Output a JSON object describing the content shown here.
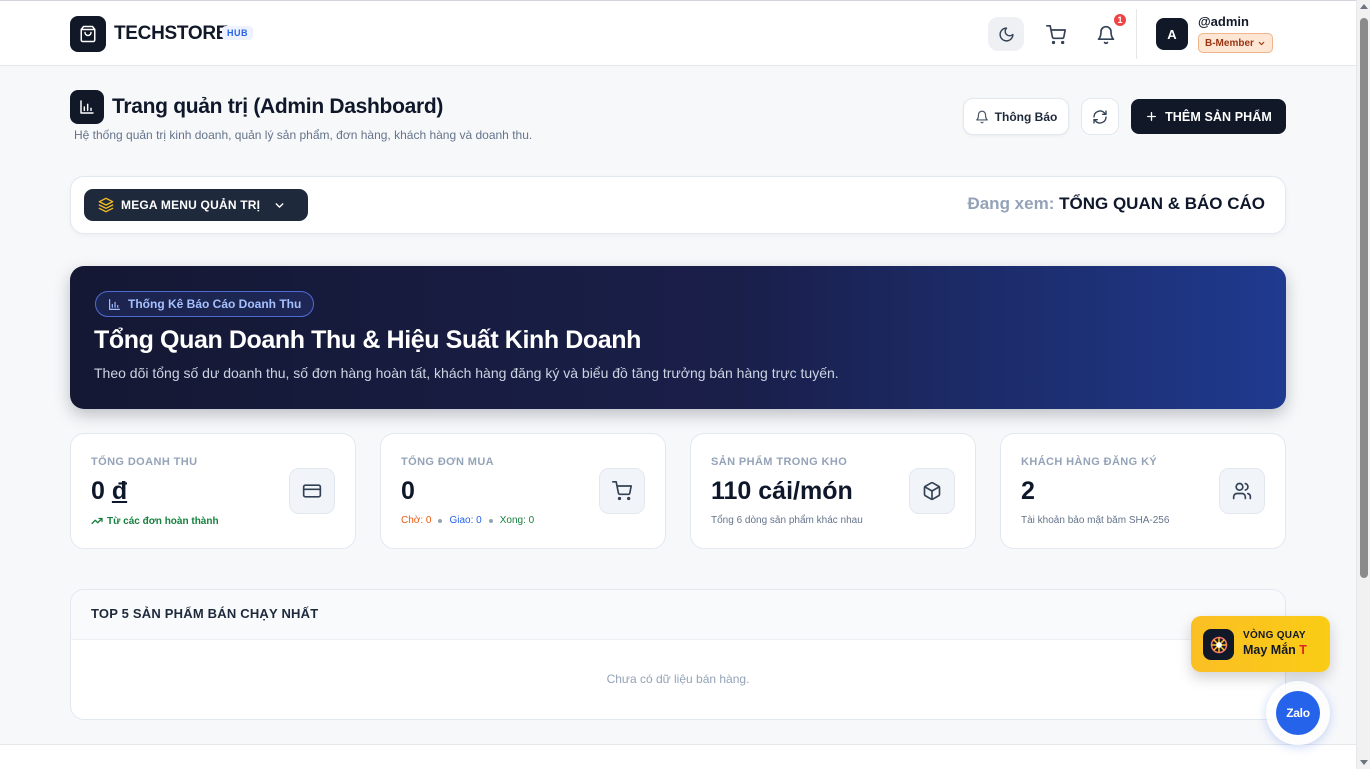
{
  "header": {
    "brand": "TECHSTORE",
    "brand_tag": "HUB",
    "notification_count": "1",
    "avatar_initial": "A",
    "username": "@admin",
    "membership": "B-Member"
  },
  "page": {
    "title": "Trang quản trị (Admin Dashboard)",
    "subtitle": "Hệ thống quản trị kinh doanh, quản lý sản phẩm, đơn hàng, khách hàng và doanh thu.",
    "notice_button": "Thông Báo",
    "add_button": "THÊM SẢN PHẨM"
  },
  "menubar": {
    "mega_menu_label": "MEGA MENU QUẢN TRỊ",
    "viewing_label": "Đang xem:",
    "viewing_value": "TỔNG QUAN & BÁO CÁO"
  },
  "hero": {
    "tag": "Thống Kê Báo Cáo Doanh Thu",
    "title": "Tổng Quan Doanh Thu & Hiệu Suất Kinh Doanh",
    "subtitle": "Theo dõi tổng số dư doanh thu, số đơn hàng hoàn tất, khách hàng đăng ký và biểu đồ tăng trưởng bán hàng trực tuyến."
  },
  "stats": [
    {
      "label": "TỔNG DOANH THU",
      "value": "0",
      "unit": "đ",
      "note": "Từ các đơn hoàn thành",
      "icon": "credit-card-icon"
    },
    {
      "label": "TỔNG ĐƠN MUA",
      "value": "0",
      "note_pending": "Chờ: 0",
      "note_shipping": "Giao: 0",
      "note_done": "Xong: 0",
      "icon": "cart-icon"
    },
    {
      "label": "SẢN PHẨM TRONG KHO",
      "value": "110 cái/món",
      "note": "Tổng 6 dòng sản phẩm khác nhau",
      "icon": "box-icon"
    },
    {
      "label": "KHÁCH HÀNG ĐĂNG KÝ",
      "value": "2",
      "note": "Tài khoản bảo mật băm SHA-256",
      "icon": "users-icon"
    }
  ],
  "top_products": {
    "title": "TOP 5 SẢN PHẨM BÁN CHẠY NHẤT",
    "empty_text": "Chưa có dữ liệu bán hàng."
  },
  "floating": {
    "wheel_line1": "VÒNG QUAY",
    "wheel_line2": "May Mắn",
    "wheel_mark": "T",
    "zalo": "Zalo"
  },
  "colors": {
    "primary_dark": "#111827",
    "accent_blue": "#2563eb",
    "badge_red": "#ef4444",
    "success_green": "#15803d",
    "pending_orange": "#ea580c"
  }
}
